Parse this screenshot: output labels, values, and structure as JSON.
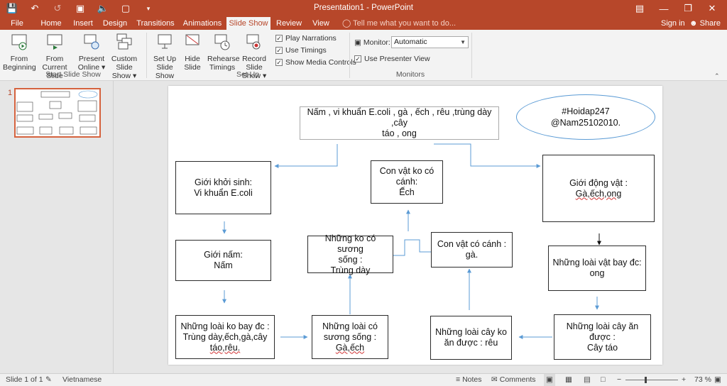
{
  "window": {
    "title": "Presentation1 - PowerPoint"
  },
  "tabs": [
    "File",
    "Home",
    "Insert",
    "Design",
    "Transitions",
    "Animations",
    "Slide Show",
    "Review",
    "View"
  ],
  "tellme": "Tell me what you want to do...",
  "account": {
    "signin": "Sign in",
    "share": "Share"
  },
  "ribbon": {
    "start": {
      "from_beginning": [
        "From",
        "Beginning"
      ],
      "from_current": [
        "From",
        "Current Slide"
      ],
      "present_online": [
        "Present",
        "Online ▾"
      ],
      "custom": [
        "Custom Slide",
        "Show ▾"
      ],
      "label": "Start Slide Show"
    },
    "setup": {
      "setup_show": [
        "Set Up",
        "Slide Show"
      ],
      "hide_slide": [
        "Hide",
        "Slide"
      ],
      "rehearse": [
        "Rehearse",
        "Timings"
      ],
      "record": [
        "Record Slide",
        "Show ▾"
      ],
      "play_narrations": "Play Narrations",
      "use_timings": "Use Timings",
      "show_media": "Show Media Controls",
      "label": "Set Up"
    },
    "monitors": {
      "monitor_label": "Monitor:",
      "monitor_value": "Automatic",
      "presenter_view": "Use Presenter View",
      "label": "Monitors"
    }
  },
  "thumb": {
    "number": "1"
  },
  "slide": {
    "top": [
      "Nấm , vi khuẩn E.coli , gà , ếch , rêu ,trùng dày ,cây",
      "táo , ong"
    ],
    "ellipse": [
      "#Hoidap247",
      "@Nam25102010."
    ],
    "khoi_sinh": [
      "Giới khởi sinh:",
      "Vi khuẩn E.coli"
    ],
    "ko_canh": [
      "Con vật ko có",
      "cánh:",
      "Ếch"
    ],
    "dong_vat": [
      "Giới động vật :",
      "Gà,ếch,ong"
    ],
    "nam": [
      "Giới nấm:",
      "Nấm"
    ],
    "ko_suong": [
      "Những ko có sương",
      "sống :",
      "Trùng dày"
    ],
    "co_canh": [
      "Con vật có cánh :",
      "gà."
    ],
    "bay_duoc": [
      "Những loài vật bay đc:",
      "ong"
    ],
    "ko_bay": [
      "Những loài ko bay đc :",
      "Trùng dày,ếch,gà,cây",
      "táo,rêu."
    ],
    "co_suong": [
      "Những loài có",
      "sương sống :",
      "Gà,ếch"
    ],
    "cay_ko_an": [
      "Những loài cây ko",
      "ăn được : rêu"
    ],
    "cay_an": [
      "Những loài cây ăn",
      "được :",
      "Cây táo"
    ]
  },
  "status": {
    "slide_info": "Slide 1 of 1",
    "language": "Vietnamese",
    "notes": "Notes",
    "comments": "Comments",
    "zoom": "73 %"
  }
}
